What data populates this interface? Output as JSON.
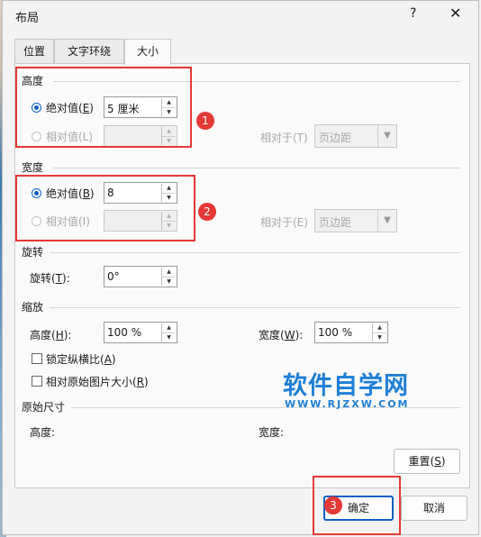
{
  "window": {
    "title": "布局",
    "help": "?",
    "close": "✕"
  },
  "tabs": [
    {
      "label": "位置"
    },
    {
      "label": "文字环绕"
    },
    {
      "label": "大小"
    }
  ],
  "height": {
    "section": "高度",
    "absolute_label": "绝对值(",
    "absolute_key": "E",
    "absolute_value": "5 厘米",
    "relative_label": "相对值(L)",
    "relative_to_label": "相对于(T)",
    "relative_to_value": "页边距"
  },
  "width": {
    "section": "宽度",
    "absolute_label": "绝对值(",
    "absolute_key": "B",
    "absolute_value": "8",
    "relative_label": "相对值(I)",
    "relative_to_label": "相对于(E)",
    "relative_to_value": "页边距"
  },
  "rotate": {
    "section": "旋转",
    "label": "旋转(",
    "key": "T",
    "suffix": "):",
    "value": "0°"
  },
  "scale": {
    "section": "缩放",
    "height_label": "高度(",
    "height_key": "H",
    "height_value": "100 %",
    "width_label": "宽度(",
    "width_key": "W",
    "width_value": "100 %",
    "lock_label": "锁定纵横比(",
    "lock_key": "A",
    "relative_label": "相对原始图片大小(",
    "relative_key": "R"
  },
  "original": {
    "section": "原始尺寸",
    "height_label": "高度:",
    "width_label": "宽度:"
  },
  "buttons": {
    "reset": "重置(",
    "reset_key": "S",
    "ok": "确定",
    "cancel": "取消"
  },
  "annotations": {
    "one": "1",
    "two": "2",
    "three": "3"
  },
  "watermark": {
    "main": "软件自学网",
    "url": "WWW.RJZXW.COM"
  },
  "colors": {
    "accent": "#0f5fc4",
    "annotation_red": "#e53935",
    "watermark_blue": "#1e7fd6"
  }
}
